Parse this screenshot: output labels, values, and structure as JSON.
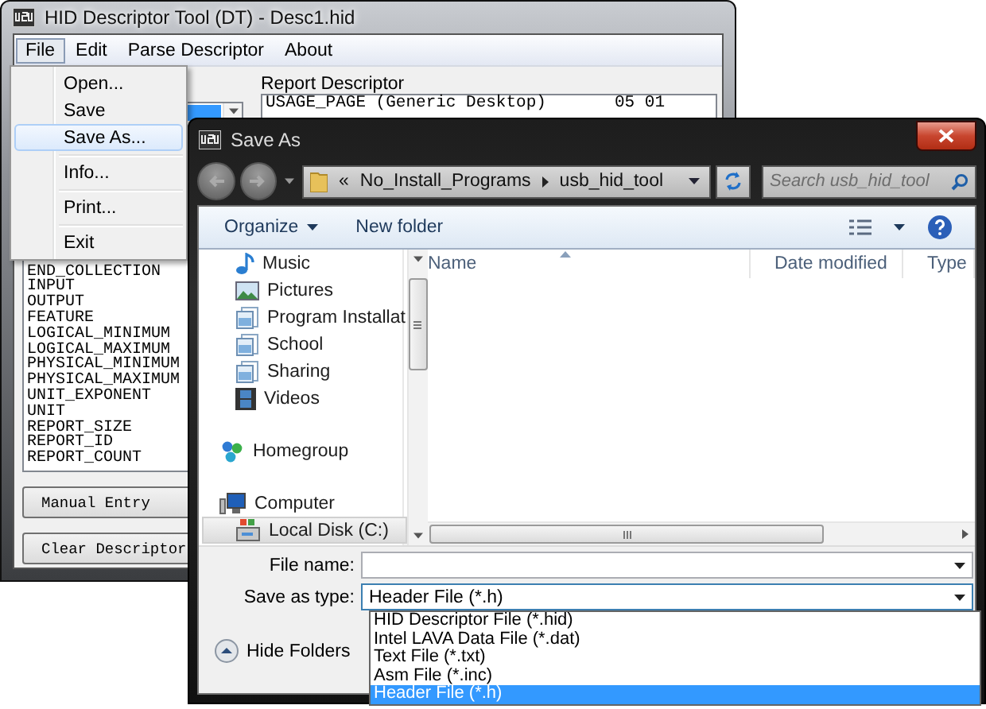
{
  "main_window": {
    "title": "HID Descriptor Tool (DT) - Desc1.hid",
    "menu": [
      {
        "label": "File",
        "selected": true
      },
      {
        "label": "Edit",
        "selected": false
      },
      {
        "label": "Parse Descriptor",
        "selected": false
      },
      {
        "label": "About",
        "selected": false
      }
    ],
    "file_menu": [
      [
        {
          "label": "Open...",
          "selected": false
        },
        {
          "label": "Save",
          "selected": false
        },
        {
          "label": "Save As...",
          "selected": true
        }
      ],
      [
        {
          "label": "Info...",
          "selected": false
        }
      ],
      [
        {
          "label": "Print...",
          "selected": false
        }
      ],
      [
        {
          "label": "Exit",
          "selected": false
        }
      ]
    ],
    "item_list": [
      "END_COLLECTION",
      "INPUT",
      "OUTPUT",
      "FEATURE",
      "LOGICAL_MINIMUM",
      "LOGICAL_MAXIMUM",
      "PHYSICAL_MINIMUM",
      "PHYSICAL_MAXIMUM",
      "UNIT_EXPONENT",
      "UNIT",
      "REPORT_SIZE",
      "REPORT_ID",
      "REPORT_COUNT"
    ],
    "report_descriptor": {
      "label": "Report Descriptor",
      "rows": [
        {
          "item": "USAGE_PAGE (Generic Desktop)",
          "bytes": "05 01"
        }
      ]
    },
    "buttons": [
      "Manual Entry",
      "Clear Descriptor"
    ]
  },
  "save_dialog": {
    "title": "Save As",
    "breadcrumb": {
      "overflow": "«",
      "parts": [
        "No_Install_Programs",
        "usb_hid_tool"
      ]
    },
    "search": {
      "placeholder": "Search usb_hid_tool"
    },
    "toolbar": {
      "organize": "Organize",
      "new_folder": "New folder"
    },
    "nav": [
      {
        "children": [
          {
            "label": "Music",
            "kind": "music",
            "selected": false
          },
          {
            "label": "Pictures",
            "kind": "pictures",
            "selected": false
          },
          {
            "label": "Program Installat",
            "kind": "library",
            "selected": false
          },
          {
            "label": "School",
            "kind": "library",
            "selected": false
          },
          {
            "label": "Sharing",
            "kind": "library",
            "selected": false
          },
          {
            "label": "Videos",
            "kind": "videos",
            "selected": false
          }
        ]
      },
      {
        "label": "Homegroup",
        "kind": "homegroup",
        "selected": false
      },
      {
        "label": "Computer",
        "kind": "computer",
        "selected": false,
        "children": [
          {
            "label": "Local Disk (C:)",
            "kind": "drive",
            "selected": true
          }
        ]
      }
    ],
    "columns": [
      {
        "label": "Name",
        "sorted": true
      },
      {
        "label": "Date modified",
        "sorted": false
      },
      {
        "label": "Type",
        "sorted": false
      }
    ],
    "file_name": {
      "label": "File name:"
    },
    "save_type": {
      "label": "Save as type:",
      "value": "Header File (*.h)",
      "options": [
        {
          "label": "HID Descriptor File (*.hid)",
          "selected": false
        },
        {
          "label": "Intel LAVA Data File (*.dat)",
          "selected": false
        },
        {
          "label": "Text File (*.txt)",
          "selected": false
        },
        {
          "label": "Asm File (*.inc)",
          "selected": false
        },
        {
          "label": "Header File (*.h)",
          "selected": true
        }
      ]
    },
    "hide_folders": "Hide Folders"
  }
}
